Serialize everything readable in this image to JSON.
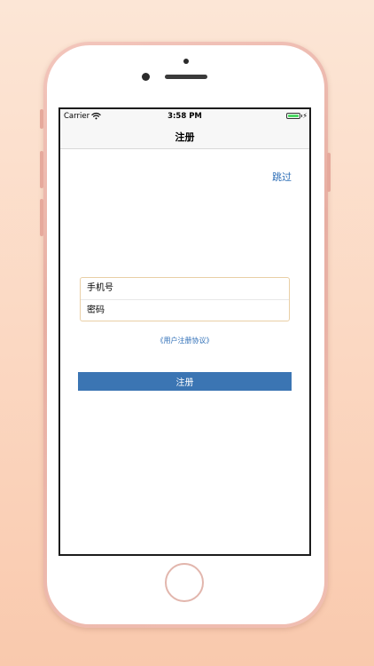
{
  "status_bar": {
    "carrier": "Carrier",
    "time": "3:58 PM",
    "battery_level": 1.0,
    "icons": [
      "wifi-icon",
      "battery-icon",
      "charging-bolt-icon"
    ],
    "bolt_glyph": "⚡"
  },
  "nav": {
    "title": "注册"
  },
  "content": {
    "skip_label": "跳过",
    "phone_placeholder": "手机号",
    "password_placeholder": "密码",
    "agreement_label": "《用户注册协议》",
    "register_label": "注册"
  },
  "colors": {
    "accent": "#2f6fb7",
    "button": "#3b75b3",
    "battery": "#4cd964",
    "card_border": "#e9cfa6",
    "phone_body": "#e7aea2"
  }
}
